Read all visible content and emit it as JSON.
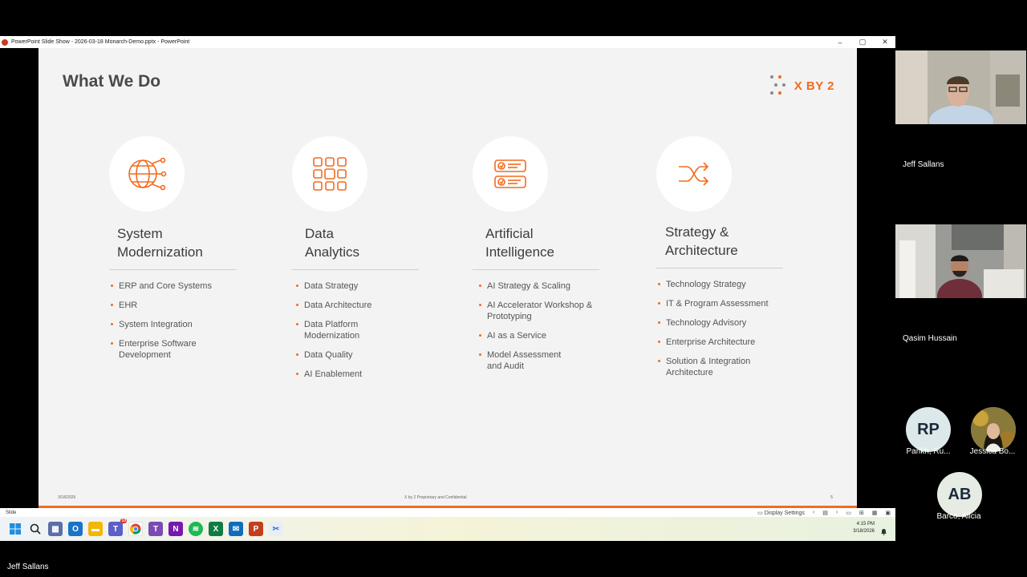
{
  "window": {
    "title": "PowerPoint Slide Show  -  2026-03-18 Monarch-Demo.pptx - PowerPoint",
    "controls": [
      "–",
      "▢",
      "✕"
    ]
  },
  "slide": {
    "title": "What We Do",
    "logo_text": "X BY 2",
    "columns": [
      {
        "icon": "globe-network-icon",
        "title_line1": "System",
        "title_line2": "Modernization",
        "items": [
          "ERP and Core Systems",
          "EHR",
          "System Integration",
          "Enterprise Software Development"
        ]
      },
      {
        "icon": "data-grid-icon",
        "title_line1": "Data",
        "title_line2": "Analytics",
        "items": [
          "Data Strategy",
          "Data Architecture",
          "Data Platform Modernization",
          "Data Quality",
          "AI Enablement"
        ]
      },
      {
        "icon": "checklist-icon",
        "title_line1": "Artificial",
        "title_line2": "Intelligence",
        "items": [
          "AI Strategy & Scaling",
          "AI Accelerator Workshop & Prototyping",
          "AI as a Service",
          "Model Assessment and Audit"
        ]
      },
      {
        "icon": "shuffle-icon",
        "title_line1": "Strategy &",
        "title_line2": "Architecture",
        "items": [
          "Technology Strategy",
          "IT & Program Assessment",
          "Technology Advisory",
          "Enterprise Architecture",
          "Solution & Integration Architecture"
        ]
      }
    ],
    "footer_date": "3/18/2026",
    "footer_confidential": "X by 2 Proprietary and Confidential",
    "footer_page": "5"
  },
  "statusbar": {
    "left_label": "Slide",
    "display_settings": "Display Settings"
  },
  "taskbar": {
    "time": "4:15 PM",
    "date": "3/18/2026",
    "badge_count": "10"
  },
  "participants": {
    "video": [
      {
        "name": "Jeff Sallans"
      },
      {
        "name": "Qasim Hussain"
      }
    ],
    "avatars": [
      {
        "initials": "RP",
        "name": "Parikh, Ru...",
        "color": "#dde8ea"
      },
      {
        "initials": "",
        "name": "Jessica Bo...",
        "color": "#8a7a3a"
      },
      {
        "initials": "AB",
        "name": "Barco, Alicia",
        "color": "#e6ebe3"
      }
    ]
  },
  "presenter_name": "Jeff Sallans",
  "colors": {
    "accent": "#f26b21",
    "slide_bg": "#f3f3f3",
    "text_dark": "#4a4a4a"
  }
}
